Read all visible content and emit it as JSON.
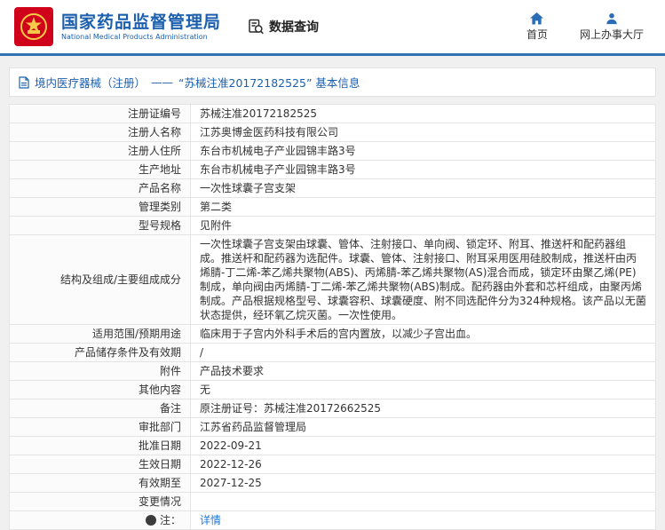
{
  "header": {
    "org_cn": "国家药品监督管理局",
    "org_en": "National Medical Products Administration",
    "data_query": "数据查询",
    "home": "首页",
    "service_hall": "网上办事大厅"
  },
  "breadcrumb": {
    "category": "境内医疗器械（注册）",
    "separator": "——",
    "title": "“苏械注准20172182525” 基本信息"
  },
  "table": {
    "rows": [
      {
        "label": "注册证编号",
        "value": "苏械注准20172182525"
      },
      {
        "label": "注册人名称",
        "value": "江苏奥博金医药科技有限公司"
      },
      {
        "label": "注册人住所",
        "value": "东台市机械电子产业园锦丰路3号"
      },
      {
        "label": "生产地址",
        "value": "东台市机械电子产业园锦丰路3号"
      },
      {
        "label": "产品名称",
        "value": "一次性球囊子宫支架"
      },
      {
        "label": "管理类别",
        "value": "第二类"
      },
      {
        "label": "型号规格",
        "value": "见附件"
      },
      {
        "label": "结构及组成/主要组成成分",
        "value": "一次性球囊子宫支架由球囊、管体、注射接口、单向阀、锁定环、附耳、推送杆和配药器组成。推送杆和配药器为选配件。球囊、管体、注射接口、附耳采用医用硅胶制成，推送杆由丙烯腈-丁二烯-苯乙烯共聚物(ABS)、丙烯腈-苯乙烯共聚物(AS)混合而成，锁定环由聚乙烯(PE)制成，单向阀由丙烯腈-丁二烯-苯乙烯共聚物(ABS)制成。配药器由外套和芯杆组成，由聚丙烯制成。产品根据规格型号、球囊容积、球囊硬度、附不同选配件分为324种规格。该产品以无菌状态提供，经环氧乙烷灭菌。一次性使用。"
      },
      {
        "label": "适用范围/预期用途",
        "value": "临床用于子宫内外科手术后的宫内置放，以减少子宫出血。"
      },
      {
        "label": "产品储存条件及有效期",
        "value": "/"
      },
      {
        "label": "附件",
        "value": "产品技术要求"
      },
      {
        "label": "其他内容",
        "value": "无"
      },
      {
        "label": "备注",
        "value": "原注册证号：苏械注准20172662525"
      },
      {
        "label": "审批部门",
        "value": "江苏省药品监督管理局"
      },
      {
        "label": "批准日期",
        "value": "2022-09-21"
      },
      {
        "label": "生效日期",
        "value": "2022-12-26"
      },
      {
        "label": "有效期至",
        "value": "2027-12-25"
      },
      {
        "label": "变更情况",
        "value": ""
      },
      {
        "label": "注：",
        "value": "详情",
        "link": true,
        "icon": "note-icon"
      }
    ]
  },
  "colors": {
    "brand_blue": "#1b5fae",
    "link_blue": "#1a7ad9",
    "header_line": "#3272b4",
    "emblem_red": "#d0021b",
    "emblem_gold": "#f7c948",
    "nav_icon_blue": "#2a6db5"
  }
}
